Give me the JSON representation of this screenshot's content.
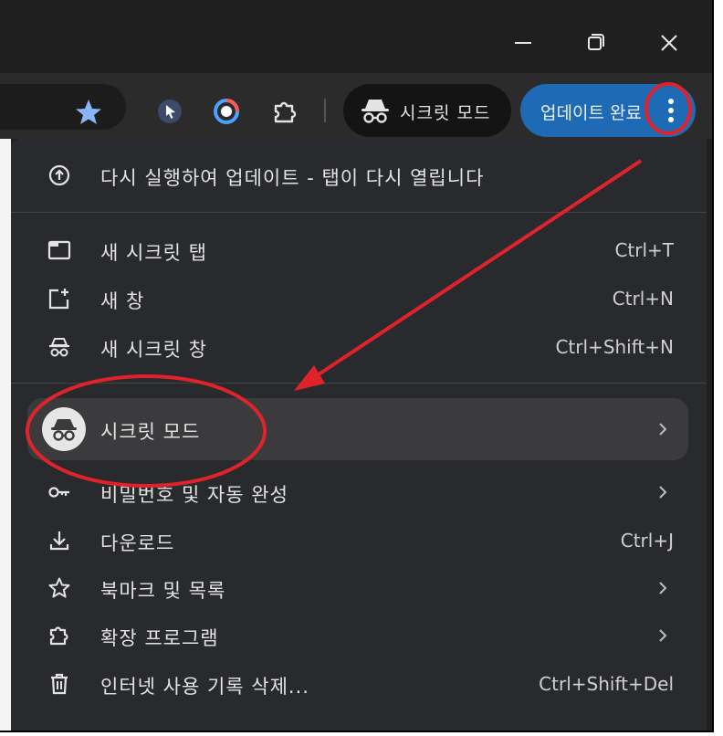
{
  "window": {
    "controls": [
      "minimize-icon",
      "restore-icon",
      "close-icon"
    ]
  },
  "toolbar": {
    "incognito_chip_label": "시크릿 모드",
    "update_button_label": "업데이트 완료"
  },
  "menu": {
    "items": [
      {
        "label": "다시 실행하여 업데이트 - 탭이 다시 열립니다",
        "shortcut": "",
        "icon": "update-icon"
      },
      {
        "label": "새 시크릿 탭",
        "shortcut": "Ctrl+T",
        "icon": "new-tab-icon"
      },
      {
        "label": "새 창",
        "shortcut": "Ctrl+N",
        "icon": "new-window-icon"
      },
      {
        "label": "새 시크릿 창",
        "shortcut": "Ctrl+Shift+N",
        "icon": "incognito-icon"
      },
      {
        "label": "시크릿 모드",
        "shortcut": "",
        "icon": "incognito-avatar-icon",
        "submenu": true
      },
      {
        "label": "비밀번호 및 자동 완성",
        "shortcut": "",
        "icon": "key-icon",
        "submenu": true
      },
      {
        "label": "다운로드",
        "shortcut": "Ctrl+J",
        "icon": "download-icon"
      },
      {
        "label": "북마크 및 목록",
        "shortcut": "",
        "icon": "star-icon",
        "submenu": true
      },
      {
        "label": "확장 프로그램",
        "shortcut": "",
        "icon": "extension-icon",
        "submenu": true
      },
      {
        "label": "인터넷 사용 기록 삭제...",
        "shortcut": "Ctrl+Shift+Del",
        "icon": "trash-icon"
      }
    ]
  },
  "colors": {
    "menu_bg": "#292a2d",
    "highlight_bg": "#3b3b3e",
    "update_blue": "#1f6ab5",
    "annotation_red": "#e0232b"
  }
}
